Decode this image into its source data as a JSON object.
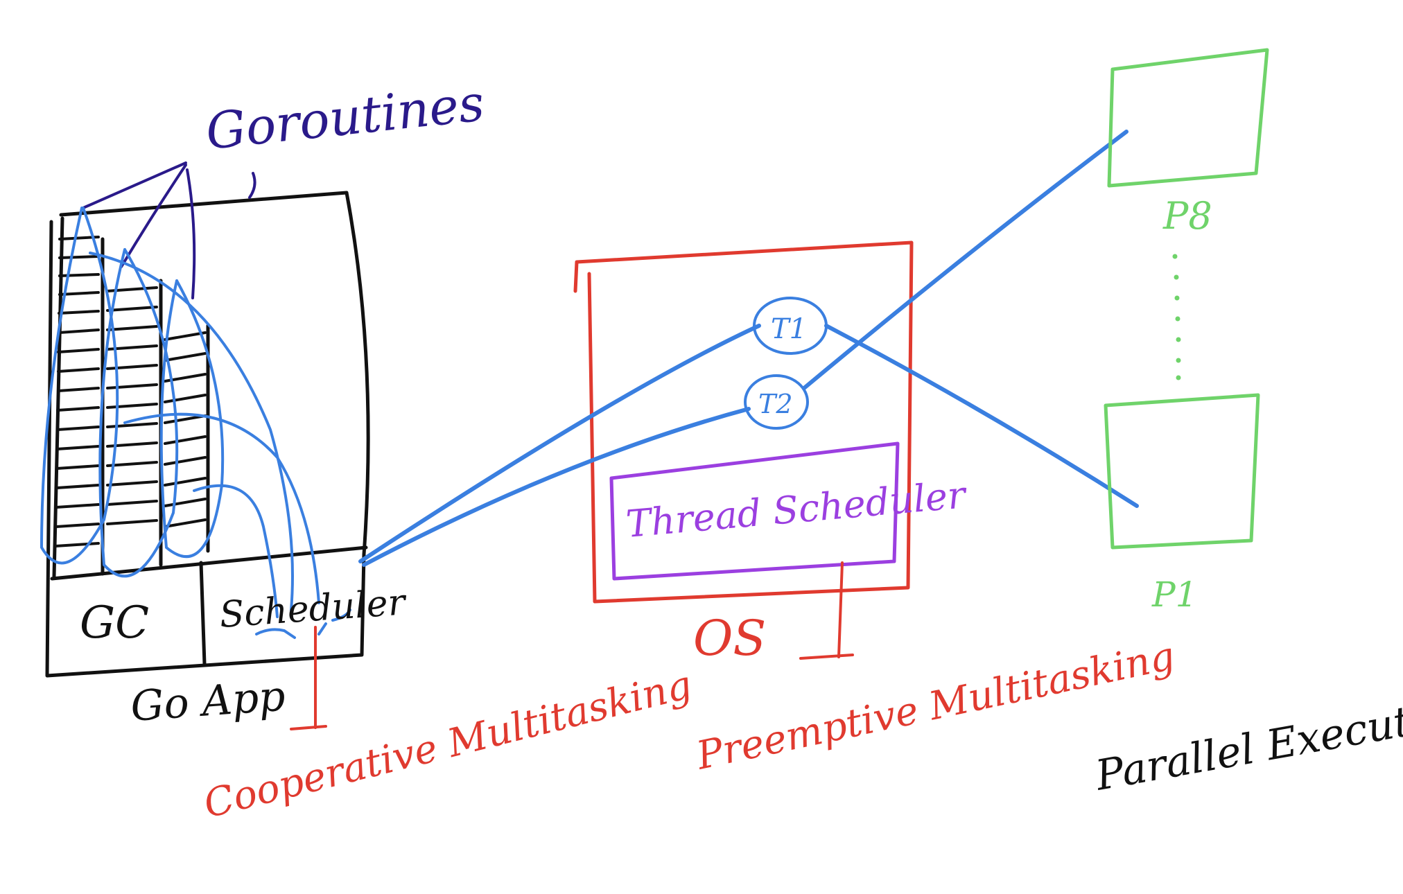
{
  "diagram": {
    "goroutines_label": "Goroutines",
    "go_app": {
      "label": "Go App",
      "gc_label": "GC",
      "scheduler_label": "Scheduler"
    },
    "os": {
      "label": "OS",
      "thread_scheduler_label": "Thread Scheduler",
      "threads": [
        "T1",
        "T2"
      ]
    },
    "processors": {
      "top_label": "P8",
      "bottom_label": "P1"
    },
    "annotations": {
      "cooperative": "Cooperative Multitasking",
      "preemptive": "Preemptive Multitasking",
      "parallel": "Parallel Execution"
    },
    "colors": {
      "goroutine_lines": "#2a1a8a",
      "connections": "#3a7fe0",
      "os_box": "#e03a2f",
      "thread_scheduler": "#9b3fe0",
      "processors": "#6fd36a",
      "annotations": "#e03a2f",
      "go_app_box": "#111111"
    }
  }
}
